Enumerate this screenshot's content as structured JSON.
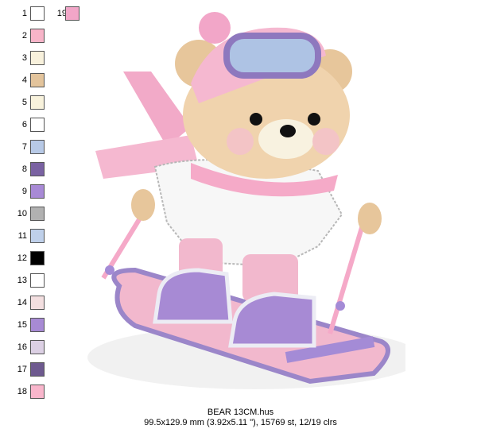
{
  "colors": [
    {
      "n": "1",
      "hex": "#ffffff"
    },
    {
      "n": "2",
      "hex": "#f7b4c8"
    },
    {
      "n": "3",
      "hex": "#f8f1dc"
    },
    {
      "n": "4",
      "hex": "#e3c49c"
    },
    {
      "n": "5",
      "hex": "#f8f2dc"
    },
    {
      "n": "6",
      "hex": "#ffffff"
    },
    {
      "n": "7",
      "hex": "#b7c9e6"
    },
    {
      "n": "8",
      "hex": "#7a62a2"
    },
    {
      "n": "9",
      "hex": "#a88ad6"
    },
    {
      "n": "10",
      "hex": "#b1b1b1"
    },
    {
      "n": "11",
      "hex": "#bfd0ea"
    },
    {
      "n": "12",
      "hex": "#000000"
    },
    {
      "n": "13",
      "hex": "#ffffff"
    },
    {
      "n": "14",
      "hex": "#f3dfe0"
    },
    {
      "n": "15",
      "hex": "#a78ad4"
    },
    {
      "n": "16",
      "hex": "#dcd0e4"
    },
    {
      "n": "17",
      "hex": "#6e5a8f"
    },
    {
      "n": "18",
      "hex": "#f9b6cc"
    }
  ],
  "extra_color": {
    "n": "19",
    "hex": "#f2a6c8"
  },
  "caption": {
    "filename": "BEAR 13CM.hus",
    "stats": "99.5x129.9 mm (3.92x5.11 \"), 15769 st, 12/19 clrs"
  }
}
